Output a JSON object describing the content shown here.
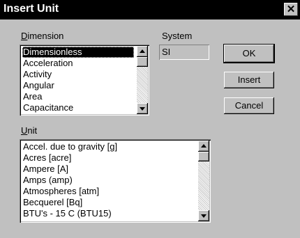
{
  "window": {
    "title": "Insert Unit",
    "close_label": "✕"
  },
  "dimension": {
    "label_accel": "D",
    "label_rest": "imension",
    "items": [
      {
        "label": "Dimensionless",
        "selected": true
      },
      {
        "label": "Acceleration",
        "selected": false
      },
      {
        "label": "Activity",
        "selected": false
      },
      {
        "label": "Angular",
        "selected": false
      },
      {
        "label": "Area",
        "selected": false
      },
      {
        "label": "Capacitance",
        "selected": false
      }
    ]
  },
  "system": {
    "label": "System",
    "value": "SI"
  },
  "unit": {
    "label_accel": "U",
    "label_rest": "nit",
    "items": [
      {
        "label": "Accel. due to gravity [g]"
      },
      {
        "label": "Acres [acre]"
      },
      {
        "label": "Ampere [A]"
      },
      {
        "label": "Amps (amp)"
      },
      {
        "label": "Atmospheres [atm]"
      },
      {
        "label": "Becquerel [Bq]"
      },
      {
        "label": "BTU's - 15 C (BTU15)"
      }
    ]
  },
  "buttons": {
    "ok": "OK",
    "insert": "Insert",
    "cancel": "Cancel"
  },
  "icons": {
    "close": "close-icon",
    "scroll_up": "arrow-up-icon",
    "scroll_down": "arrow-down-icon"
  }
}
